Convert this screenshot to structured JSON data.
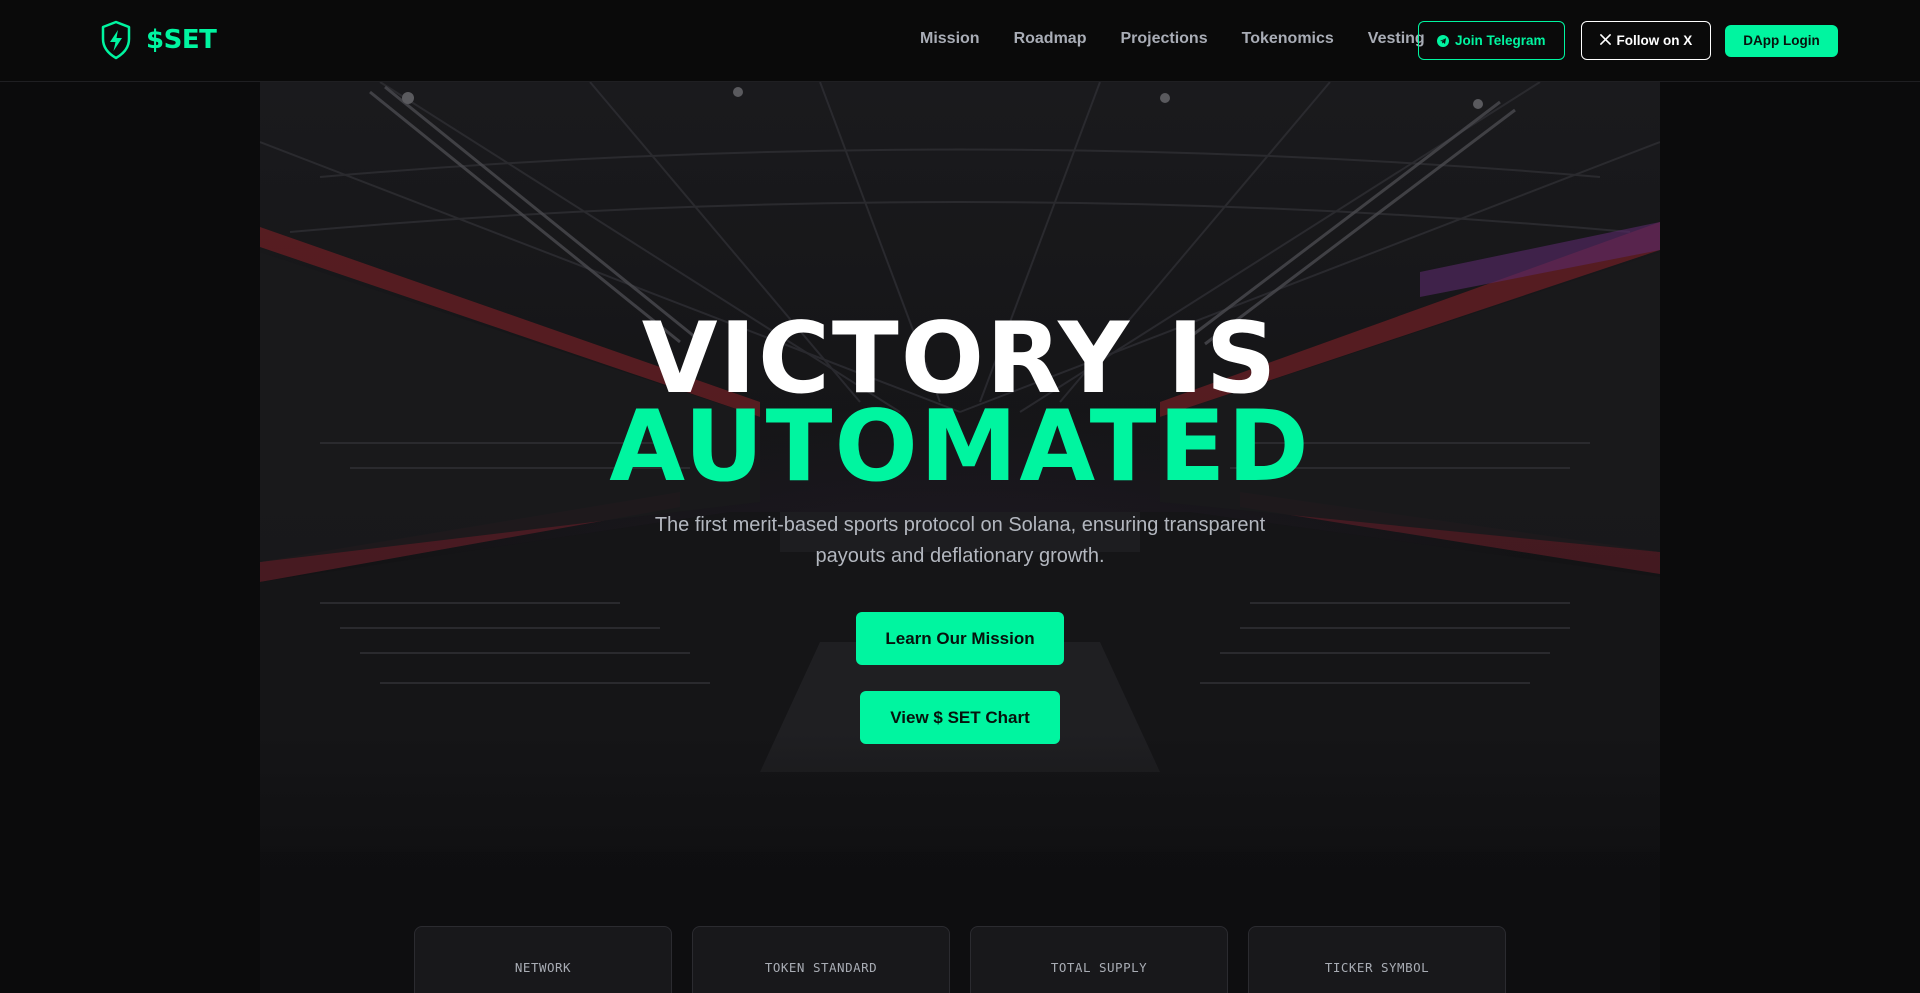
{
  "colors": {
    "accent": "#00f5a0",
    "background": "#0b0b0c",
    "nav_text": "#a9adb6",
    "subtitle_text": "#b3b7bf"
  },
  "brand": {
    "logo_icon": "shield-lightning-icon",
    "name": "$SET"
  },
  "nav": {
    "links": [
      "Mission",
      "Roadmap",
      "Projections",
      "Tokenomics",
      "Vesting"
    ],
    "telegram": {
      "icon": "telegram-icon",
      "label": "Join Telegram"
    },
    "x": {
      "icon": "x-logo-icon",
      "label": "Follow on X"
    },
    "dapp_label": "DApp Login"
  },
  "hero": {
    "title_line1": "VICTORY IS",
    "title_line2": "AUTOMATED",
    "subtitle": "The first merit-based sports protocol on Solana, ensuring transparent payouts and deflationary growth.",
    "cta_primary": "Learn Our Mission",
    "cta_secondary": "View $ SET Chart"
  },
  "stats": [
    {
      "label": "NETWORK"
    },
    {
      "label": "TOKEN STANDARD"
    },
    {
      "label": "TOTAL SUPPLY"
    },
    {
      "label": "TICKER SYMBOL"
    }
  ]
}
